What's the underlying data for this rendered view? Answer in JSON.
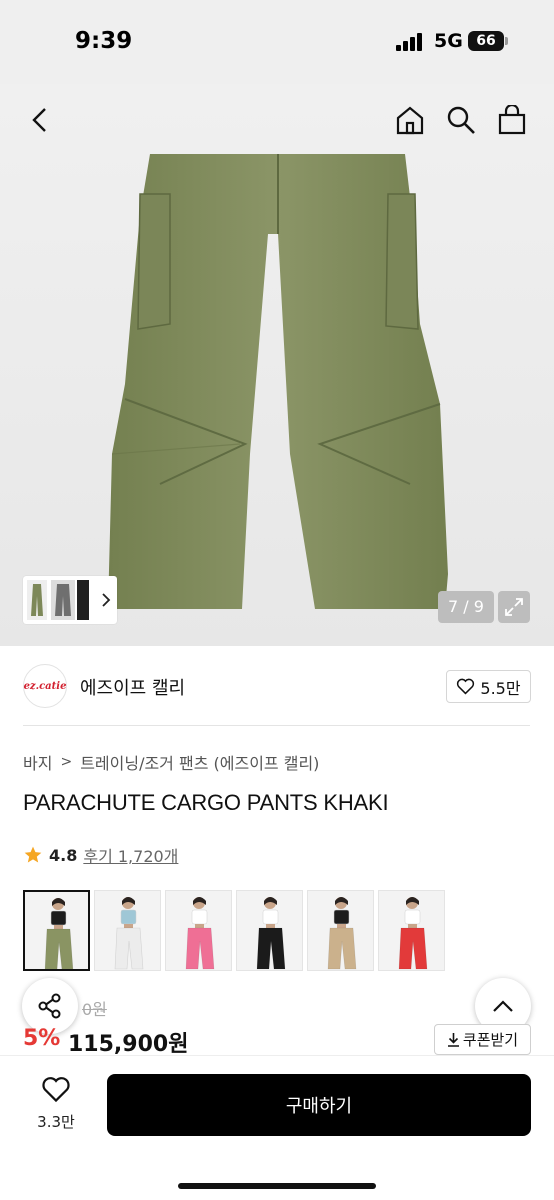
{
  "status": {
    "time": "9:39",
    "network": "5G",
    "battery": "66"
  },
  "gallery": {
    "counter": "7 / 9"
  },
  "brand": {
    "logo_text": "ez.catie",
    "name": "에즈이프 캘리",
    "likes": "5.5만"
  },
  "product": {
    "breadcrumb": [
      "바지",
      "트레이닝/조거 팬츠 (에즈이프 캘리)"
    ],
    "title": "PARACHUTE CARGO PANTS KHAKI",
    "rating": "4.8",
    "reviews": "후기 1,720개",
    "variants": [
      {
        "colorway": "khaki",
        "top": "#1d1d1d",
        "bottom": "#8a9463"
      },
      {
        "colorway": "white",
        "top": "#9fc7d6",
        "bottom": "#ececec"
      },
      {
        "colorway": "pink",
        "top": "#ffffff",
        "bottom": "#ef6f95"
      },
      {
        "colorway": "black",
        "top": "#ffffff",
        "bottom": "#1b1b1b"
      },
      {
        "colorway": "beige",
        "top": "#1d1d1d",
        "bottom": "#cbb18c"
      },
      {
        "colorway": "red",
        "top": "#ffffff",
        "bottom": "#e23a3a"
      }
    ],
    "original_price_fragment": "0원",
    "discount": "5%",
    "price": "115,900원",
    "coupon": "쿠폰받기"
  },
  "bottom": {
    "wish_count": "3.3만",
    "buy_label": "구매하기"
  },
  "colors": {
    "khaki": "#7f8a5e",
    "discount_red": "#e53935"
  }
}
